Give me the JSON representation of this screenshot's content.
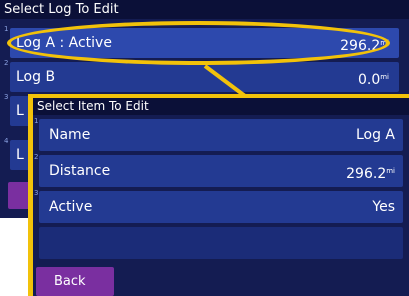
{
  "back_screen": {
    "title": "Select Log To Edit",
    "rows": [
      {
        "index": "1",
        "label": "Log A : Active",
        "value": "296.2",
        "unit": "mi"
      },
      {
        "index": "2",
        "label": "Log B",
        "value": "0.0",
        "unit": "mi"
      },
      {
        "index": "3",
        "label": "L",
        "value": "",
        "unit": ""
      },
      {
        "index": "4",
        "label": "L",
        "value": "",
        "unit": ""
      }
    ]
  },
  "front_screen": {
    "title": "Select Item To Edit",
    "rows": [
      {
        "index": "1",
        "label": "Name",
        "value": "Log A",
        "unit": ""
      },
      {
        "index": "2",
        "label": "Distance",
        "value": "296.2",
        "unit": "mi"
      },
      {
        "index": "3",
        "label": "Active",
        "value": "Yes",
        "unit": ""
      }
    ],
    "back_label": "Back"
  },
  "colors": {
    "highlight": "#f2c20a",
    "row": "#233a92",
    "panel": "#141c52",
    "button": "#7a2fa0"
  }
}
